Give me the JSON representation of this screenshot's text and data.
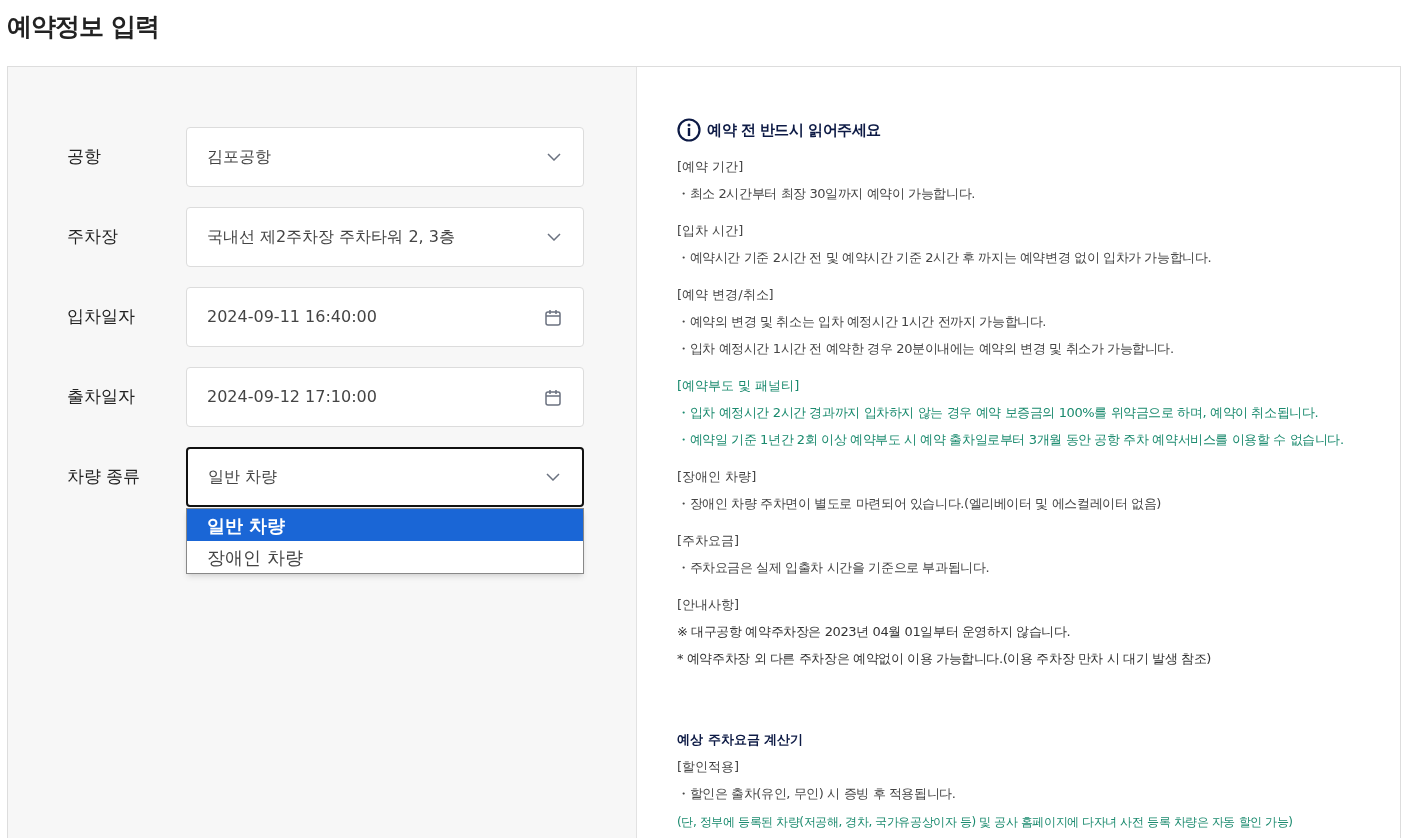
{
  "title": "예약정보 입력",
  "form": {
    "fields": [
      {
        "label": "공항",
        "kind": "select",
        "value": "김포공항",
        "focused": false
      },
      {
        "label": "주차장",
        "kind": "select",
        "value": "국내선 제2주차장 주차타워 2, 3층",
        "focused": false
      },
      {
        "label": "입차일자",
        "kind": "date",
        "value": "2024-09-11 16:40:00",
        "focused": false
      },
      {
        "label": "출차일자",
        "kind": "date",
        "value": "2024-09-12 17:10:00",
        "focused": false
      },
      {
        "label": "차량 종류",
        "kind": "select",
        "value": "일반 차량",
        "focused": true,
        "options": [
          {
            "label": "일반 차량",
            "selected": true
          },
          {
            "label": "장애인 차량",
            "selected": false
          }
        ]
      }
    ]
  },
  "notice": {
    "title": "예약 전 반드시 읽어주세요",
    "sections": [
      {
        "heading": "[예약 기간]",
        "highlight": false,
        "lines": [
          {
            "text": "・최소 2시간부터 최장 30일까지 예약이 가능합니다.",
            "kind": "bullet"
          }
        ]
      },
      {
        "heading": "[입차 시간]",
        "highlight": false,
        "lines": [
          {
            "text": "・예약시간 기준 2시간 전 및 예약시간 기준 2시간 후 까지는 예약변경 없이 입차가 가능합니다.",
            "kind": "bullet"
          }
        ]
      },
      {
        "heading": "[예약 변경/취소]",
        "highlight": false,
        "lines": [
          {
            "text": "・예약의 변경 및 취소는 입차 예정시간 1시간 전까지 가능합니다.",
            "kind": "bullet"
          },
          {
            "text": "・입차 예정시간 1시간 전 예약한 경우 20분이내에는 예약의 변경 및 취소가 가능합니다.",
            "kind": "bullet"
          }
        ]
      },
      {
        "heading": "[예약부도 및 패널티]",
        "highlight": true,
        "lines": [
          {
            "text": "・입차 예정시간 2시간 경과까지 입차하지 않는 경우 예약 보증금의 100%를 위약금으로 하며, 예약이 취소됩니다.",
            "kind": "bullet"
          },
          {
            "text": "・예약일 기준 1년간 2회 이상 예약부도 시 예약 출차일로부터 3개월 동안 공항 주차 예약서비스를 이용할 수 없습니다.",
            "kind": "bullet"
          }
        ]
      },
      {
        "heading": "[장애인 차량]",
        "highlight": false,
        "lines": [
          {
            "text": "・장애인 차량 주차면이 별도로 마련되어 있습니다.(엘리베이터 및 에스컬레이터 없음)",
            "kind": "bullet"
          }
        ]
      },
      {
        "heading": "[주차요금]",
        "highlight": false,
        "lines": [
          {
            "text": "・주차요금은 실제 입출차 시간을 기준으로 부과됩니다.",
            "kind": "bullet"
          }
        ]
      },
      {
        "heading": "[안내사항]",
        "highlight": false,
        "lines": [
          {
            "text": "※ 대구공항 예약주차장은 2023년 04월 01일부터 운영하지 않습니다.",
            "kind": "plain"
          },
          {
            "text": "* 예약주차장 외 다른 주차장은 예약없이 이용 가능합니다.(이용 주차장 만차 시 대기 발생 참조)",
            "kind": "plain"
          }
        ]
      }
    ]
  },
  "calculator": {
    "title": "예상 주차요금 계산기",
    "sections": [
      {
        "heading": "[할인적용]",
        "highlight": false,
        "lines": [
          {
            "text": "・할인은 출차(유인, 무인) 시 증빙 후 적용됩니다.",
            "kind": "bullet"
          },
          {
            "text": "(단, 정부에 등록된 차량(저공해, 경차, 국가유공상이자 등) 및 공사 홈페이지에 다자녀 사전 등록 차량은 자동 할인 가능)",
            "kind": "note"
          }
        ]
      }
    ]
  }
}
